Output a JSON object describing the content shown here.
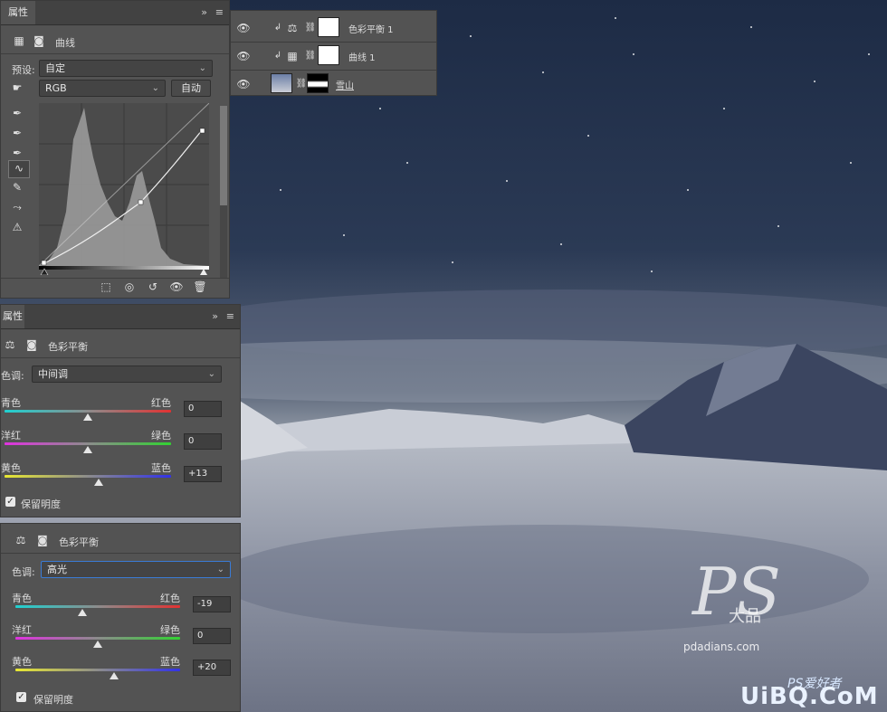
{
  "watermark": {
    "brand_site": "pdadians.com",
    "site2": "UiBQ.CoM",
    "site2_sub": "PS爱好者",
    "ps_text": "PS",
    "ps_sub": "大品"
  },
  "layers": {
    "rows": [
      {
        "name": "色彩平衡 1"
      },
      {
        "name": "曲线 1"
      },
      {
        "name": "雪山"
      }
    ]
  },
  "curves_panel": {
    "tab": "属性",
    "menu_glyph": "≡",
    "collapse_glyph": "»",
    "title": "曲线",
    "preset_label": "预设:",
    "preset_value": "自定",
    "channel_value": "RGB",
    "auto_label": "自动"
  },
  "cb_mid": {
    "tab": "属性",
    "menu_glyph": "≡",
    "collapse_glyph": "»",
    "title": "色彩平衡",
    "tone_label": "色调:",
    "tone_value": "中间调",
    "sliders": [
      {
        "left": "青色",
        "right": "红色",
        "value": "0",
        "pos": 0
      },
      {
        "left": "洋红",
        "right": "绿色",
        "value": "0",
        "pos": 0
      },
      {
        "left": "黄色",
        "right": "蓝色",
        "value": "+13",
        "pos": 13
      }
    ],
    "preserve_label": "保留明度"
  },
  "cb_high": {
    "title": "色彩平衡",
    "tone_label": "色调:",
    "tone_value": "高光",
    "sliders": [
      {
        "left": "青色",
        "right": "红色",
        "value": "-19",
        "pos": -19
      },
      {
        "left": "洋红",
        "right": "绿色",
        "value": "0",
        "pos": 0
      },
      {
        "left": "黄色",
        "right": "蓝色",
        "value": "+20",
        "pos": 20
      }
    ],
    "preserve_label": "保留明度"
  },
  "colors": {
    "panel": "#535353",
    "dark": "#424242",
    "accent": "#3a7bd5"
  }
}
